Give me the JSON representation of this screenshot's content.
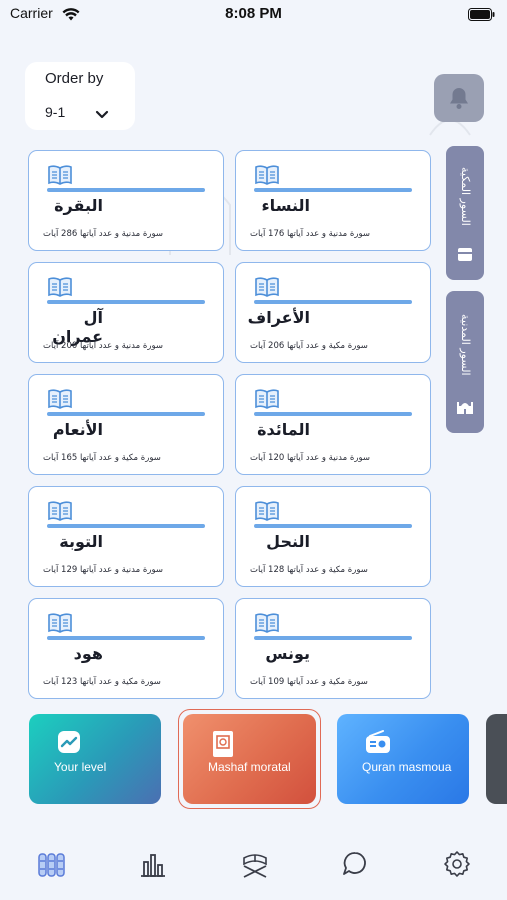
{
  "status_bar": {
    "carrier": "Carrier",
    "time": "8:08 PM"
  },
  "order_by": {
    "label": "Order by",
    "value": "9-1"
  },
  "side_tabs": [
    {
      "label": "السور المكية",
      "icon": "kaaba-icon"
    },
    {
      "label": "السور المدنية",
      "icon": "mosque-icon"
    }
  ],
  "surahs": [
    {
      "name": "النساء",
      "info": "سورة مدنية و عدد آياتها 176 آيات"
    },
    {
      "name": "البقرة",
      "info": "سورة مدنية و عدد آياتها 286 آيات"
    },
    {
      "name": "الأعراف",
      "info": "سورة مكية و عدد آياتها 206 آيات"
    },
    {
      "name": "آل عمران",
      "info": "سورة مدنية و عدد آياتها 200 آيات"
    },
    {
      "name": "المائدة",
      "info": "سورة مدنية و عدد آياتها 120 آيات"
    },
    {
      "name": "الأنعام",
      "info": "سورة مكية و عدد آياتها 165 آيات"
    },
    {
      "name": "النحل",
      "info": "سورة مكية و عدد آياتها 128 آيات"
    },
    {
      "name": "التوبة",
      "info": "سورة مدنية و عدد آياتها 129 آيات"
    },
    {
      "name": "يونس",
      "info": "سورة مكية و عدد آياتها 109 آيات"
    },
    {
      "name": "هود",
      "info": "سورة مكية و عدد آياتها 123 آيات"
    }
  ],
  "features": [
    {
      "label": "Your level",
      "icon": "trend-chart-icon"
    },
    {
      "label": "Mashaf moratal",
      "icon": "quran-book-icon"
    },
    {
      "label": "Quran masmoua",
      "icon": "radio-icon"
    }
  ],
  "tab_bar": [
    {
      "name": "library",
      "icon": "books-icon"
    },
    {
      "name": "stats",
      "icon": "bar-chart-icon"
    },
    {
      "name": "quran",
      "icon": "quran-stand-icon"
    },
    {
      "name": "chat",
      "icon": "chat-icon"
    },
    {
      "name": "settings",
      "icon": "gear-icon"
    }
  ],
  "colors": {
    "card_border": "#8fb7ec",
    "progress": "#6ea8e8",
    "side_tab": "#8288aa",
    "accent_orange": "#e06d4f",
    "accent_teal": "#1ccfbf",
    "accent_blue": "#3a8ff0"
  }
}
